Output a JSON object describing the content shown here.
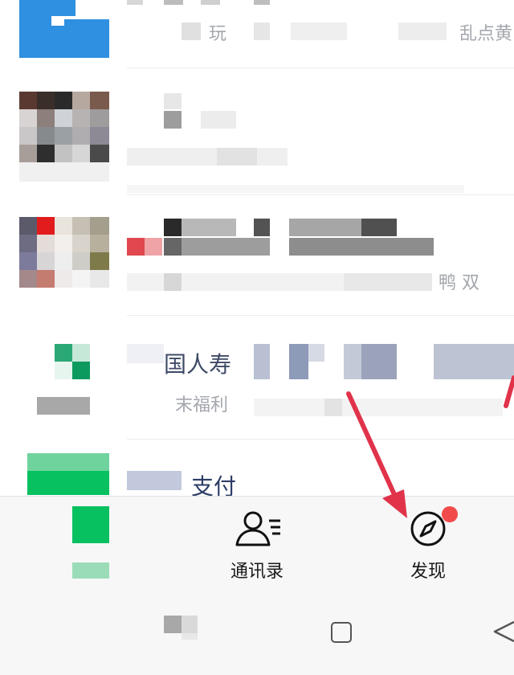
{
  "chat_list": [
    {
      "name": "",
      "preview": "玩",
      "preview_tail": "乱点黄"
    },
    {
      "name": "",
      "preview": "",
      "preview_tail": ""
    },
    {
      "name": "",
      "preview": "",
      "preview_tail": "鸭 双"
    },
    {
      "name": "国人寿",
      "preview": "末福利",
      "preview_tail": ""
    },
    {
      "name": "支付",
      "preview": "",
      "preview_tail": ""
    }
  ],
  "tabbar": {
    "contacts_label": "通讯录",
    "discover_label": "发现",
    "discover_badge_color": "#f24b4b"
  },
  "colors": {
    "tab_background": "#f7f7f7",
    "annotation_arrow": "#e0334a",
    "brand_green": "#07c160"
  }
}
